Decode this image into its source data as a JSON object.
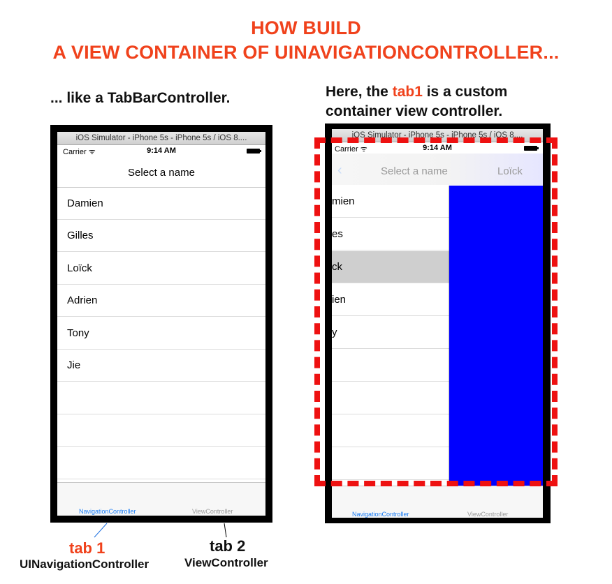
{
  "heading": {
    "line1": "HOW BUILD",
    "line2": "A VIEW CONTAINER OF UINAVIGATIONCONTROLLER..."
  },
  "left_caption": "... like a TabBarController.",
  "right_caption": {
    "prefix": "Here, the ",
    "highlight": "tab1",
    "suffix": " is a custom",
    "line2": "container view controller."
  },
  "simulator_title": "iOS Simulator - iPhone 5s - iPhone 5s / iOS 8....",
  "status": {
    "carrier": "Carrier",
    "time": "9:14 AM"
  },
  "left_phone": {
    "nav_title": "Select a name",
    "rows": [
      "Damien",
      "Gilles",
      "Loïck",
      "Adrien",
      "Tony",
      "Jie"
    ],
    "tabs": [
      "NavigationController",
      "ViewController"
    ]
  },
  "right_phone": {
    "nav_title": "Select a name",
    "nav_right": "Loïck",
    "rows": [
      "mien",
      "es",
      "ck",
      "ien",
      "y"
    ],
    "tabs": [
      "NavigationController",
      "ViewController"
    ]
  },
  "labels": {
    "tab1": "tab 1",
    "tab1_sub": "UINavigationController",
    "tab2": "tab 2",
    "tab2_sub": "ViewController"
  },
  "colors": {
    "accent": "#f0421c",
    "dash_red": "#ee1111",
    "tab_blue": "#1a7cf4",
    "panel_blue": "#0000ff"
  }
}
